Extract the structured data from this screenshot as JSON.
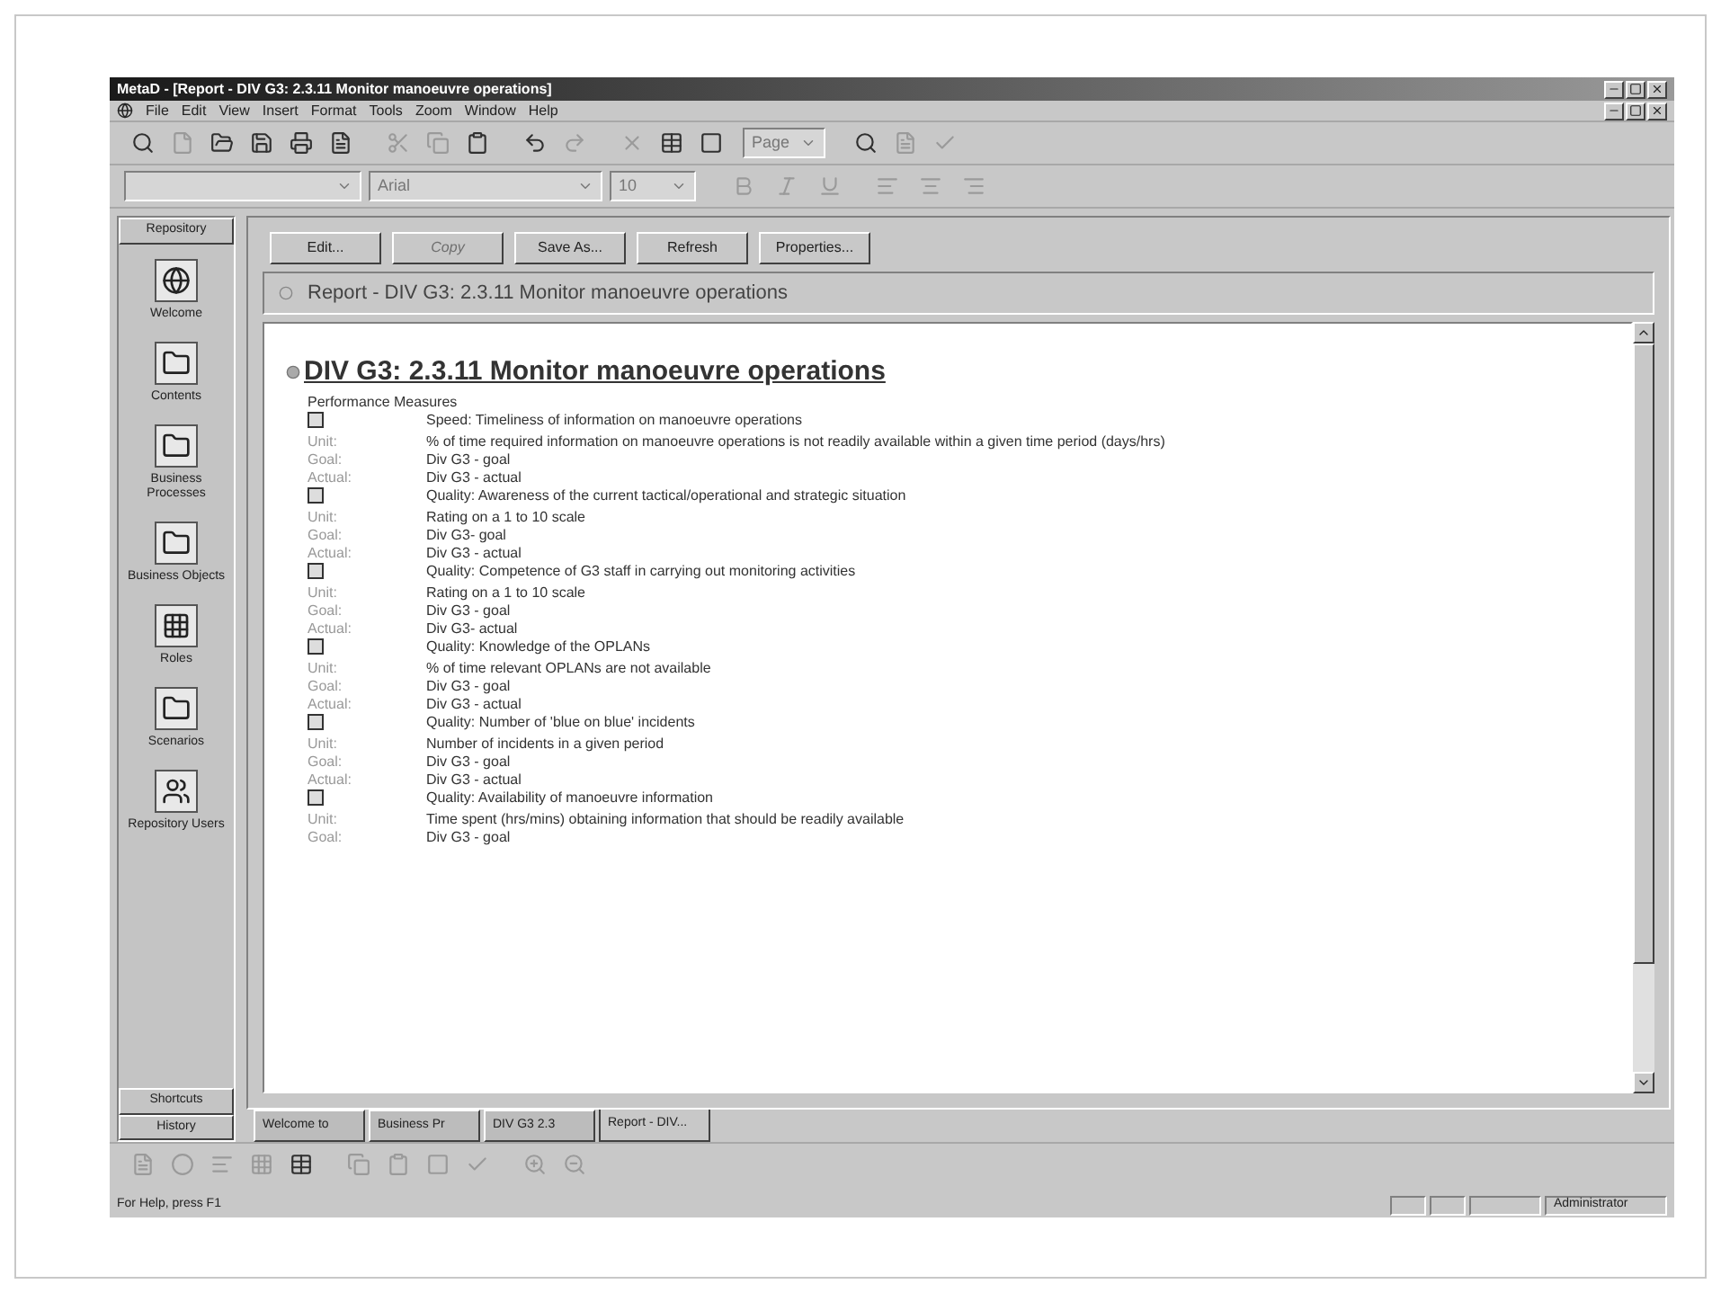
{
  "window": {
    "title": "MetaD - [Report - DIV G3: 2.3.11 Monitor manoeuvre operations]"
  },
  "menu": [
    {
      "label": "File"
    },
    {
      "label": "Edit"
    },
    {
      "label": "View"
    },
    {
      "label": "Insert"
    },
    {
      "label": "Format"
    },
    {
      "label": "Tools"
    },
    {
      "label": "Zoom"
    },
    {
      "label": "Window"
    },
    {
      "label": "Help"
    }
  ],
  "toolbar": {
    "page_combo": "Page"
  },
  "format_toolbar": {
    "font": "Arial",
    "size": "10"
  },
  "sidebar": {
    "header": "Repository",
    "items": [
      {
        "label": "Welcome",
        "kind": "globe",
        "selected": false
      },
      {
        "label": "Contents",
        "kind": "folder",
        "selected": false
      },
      {
        "label": "Business Processes",
        "kind": "folder",
        "selected": false
      },
      {
        "label": "Business Objects",
        "kind": "folder",
        "selected": false
      },
      {
        "label": "Roles",
        "kind": "grid",
        "selected": false
      },
      {
        "label": "Scenarios",
        "kind": "folder",
        "selected": false
      },
      {
        "label": "Repository Users",
        "kind": "users",
        "selected": false
      }
    ],
    "footer": [
      "Shortcuts",
      "History"
    ]
  },
  "action_buttons": [
    {
      "label": "Edit...",
      "disabled": false
    },
    {
      "label": "Copy",
      "disabled": true
    },
    {
      "label": "Save As...",
      "disabled": false
    },
    {
      "label": "Refresh",
      "disabled": false
    },
    {
      "label": "Properties...",
      "disabled": false
    }
  ],
  "report_header": "Report - DIV G3: 2.3.11 Monitor manoeuvre operations",
  "document": {
    "heading": "DIV G3: 2.3.11 Monitor manoeuvre operations",
    "subheading": "Performance Measures",
    "measures": [
      {
        "title": "Speed: Timeliness of information on manoeuvre operations",
        "rows": [
          {
            "label": "Unit:",
            "value": "% of time required information on manoeuvre operations is not readily available within a given time period (days/hrs)"
          },
          {
            "label": "Goal:",
            "value": "Div G3 - goal"
          },
          {
            "label": "Actual:",
            "value": "Div G3 - actual"
          }
        ]
      },
      {
        "title": "Quality: Awareness of the current tactical/operational and strategic situation",
        "rows": [
          {
            "label": "Unit:",
            "value": "Rating on a 1 to 10 scale"
          },
          {
            "label": "Goal:",
            "value": "Div G3- goal"
          },
          {
            "label": "Actual:",
            "value": "Div G3 - actual"
          }
        ]
      },
      {
        "title": "Quality: Competence of G3 staff in carrying out monitoring activities",
        "rows": [
          {
            "label": "Unit:",
            "value": "Rating on a 1 to 10 scale"
          },
          {
            "label": "Goal:",
            "value": "Div G3 - goal"
          },
          {
            "label": "Actual:",
            "value": "Div G3- actual"
          }
        ]
      },
      {
        "title": "Quality: Knowledge of the OPLANs",
        "rows": [
          {
            "label": "Unit:",
            "value": "% of time relevant OPLANs are not available"
          },
          {
            "label": "Goal:",
            "value": "Div G3 - goal"
          },
          {
            "label": "Actual:",
            "value": "Div G3 - actual"
          }
        ]
      },
      {
        "title": "Quality: Number of 'blue on blue' incidents",
        "rows": [
          {
            "label": "Unit:",
            "value": "Number of incidents in a given period"
          },
          {
            "label": "Goal:",
            "value": "Div G3 - goal"
          },
          {
            "label": "Actual:",
            "value": "Div G3 - actual"
          }
        ]
      },
      {
        "title": "Quality: Availability of manoeuvre information",
        "rows": [
          {
            "label": "Unit:",
            "value": "Time spent (hrs/mins) obtaining information that should be readily available"
          },
          {
            "label": "Goal:",
            "value": "Div G3 - goal"
          }
        ]
      }
    ]
  },
  "tabs": [
    {
      "label": "Welcome to",
      "selected": false
    },
    {
      "label": "Business Pr",
      "selected": false
    },
    {
      "label": "DIV G3 2.3",
      "selected": false
    },
    {
      "label": "Report - DIV...",
      "selected": true
    }
  ],
  "status_bar": {
    "help": "For Help, press F1",
    "user": "Administrator"
  }
}
